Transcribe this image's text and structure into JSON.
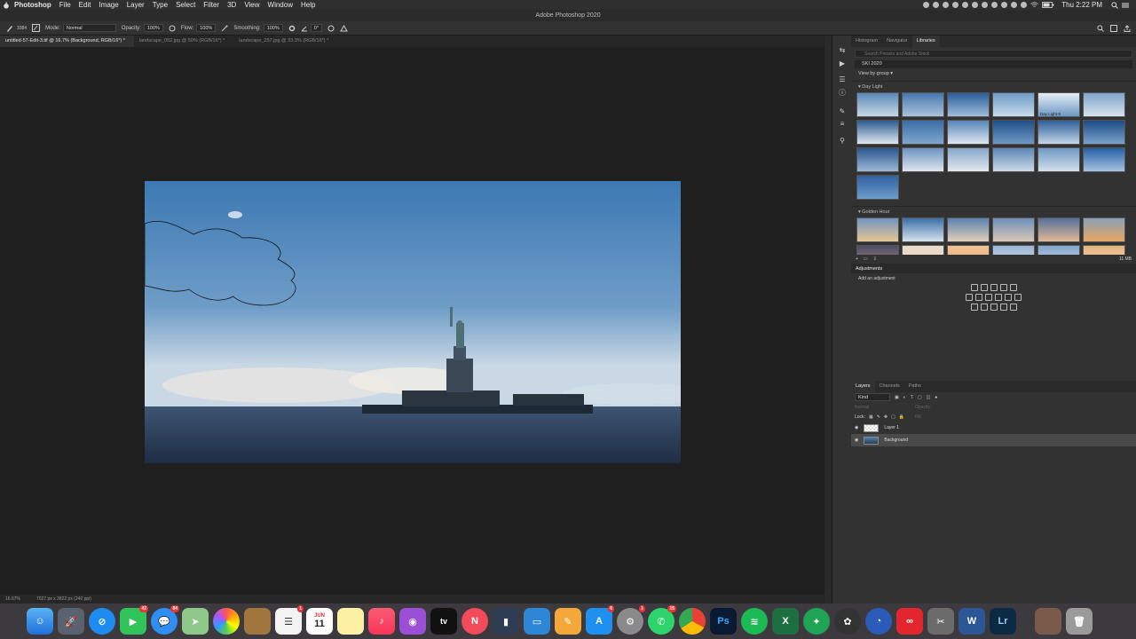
{
  "menubar": {
    "app": "Photoshop",
    "items": [
      "File",
      "Edit",
      "Image",
      "Layer",
      "Type",
      "Select",
      "Filter",
      "3D",
      "View",
      "Window",
      "Help"
    ],
    "clock": "Thu 2:22 PM"
  },
  "window": {
    "title": "Adobe Photoshop 2020"
  },
  "options": {
    "brush_size": "3384",
    "mode_label": "Mode:",
    "mode_value": "Normal",
    "opacity_label": "Opacity:",
    "opacity_value": "100%",
    "flow_label": "Flow:",
    "flow_value": "100%",
    "smoothing_label": "Smoothing:",
    "smoothing_value": "100%",
    "angle_value": "0°"
  },
  "tabs": [
    {
      "label": "untitled-57-Edit-3.tif @ 16.7% (Background, RGB/16*) *"
    },
    {
      "label": "landscape_052.jpg @ 50% (RGB/16*) *"
    },
    {
      "label": "landscape_257.jpg @ 33.3% (RGB/16*) *"
    }
  ],
  "status": {
    "zoom": "16.67%",
    "doc_size": "7027 px x 3822 px (240 ppi)"
  },
  "libraries": {
    "tabs": [
      "Histogram",
      "Navigator",
      "Libraries"
    ],
    "search_placeholder": "Search Presets and Adobe Stock",
    "library_name": "SKI 2020",
    "view_by": "View by group",
    "group1": "Day Light",
    "thumb_label": "Day Light-5",
    "group2": "Golden Hour",
    "storage": "11 MB"
  },
  "adjustments": {
    "title": "Adjustments",
    "subtitle": "Add an adjustment"
  },
  "layers": {
    "tabs": [
      "Layers",
      "Channels",
      "Paths"
    ],
    "kind": "Kind",
    "blend": "Normal",
    "opacity_label": "Opacity:",
    "lock_label": "Lock:",
    "fill_label": "Fill:",
    "rows": [
      {
        "name": "Layer 1"
      },
      {
        "name": "Background"
      }
    ]
  },
  "dock": {
    "badges": {
      "facetime": "42",
      "messages": "84",
      "calendar_day": "11",
      "reminders": "1",
      "music": "1",
      "appstore": "6",
      "prefs": "1",
      "whatsapp": "15"
    },
    "calendar_month": "JUN",
    "ps_label": "Ps",
    "lr_label": "Lr",
    "word_label": "W",
    "excel_label": "X",
    "tv_label": "tv"
  },
  "colors": {
    "accent": "#1473e6",
    "panel": "#323232",
    "canvas": "#1f1f1f"
  }
}
